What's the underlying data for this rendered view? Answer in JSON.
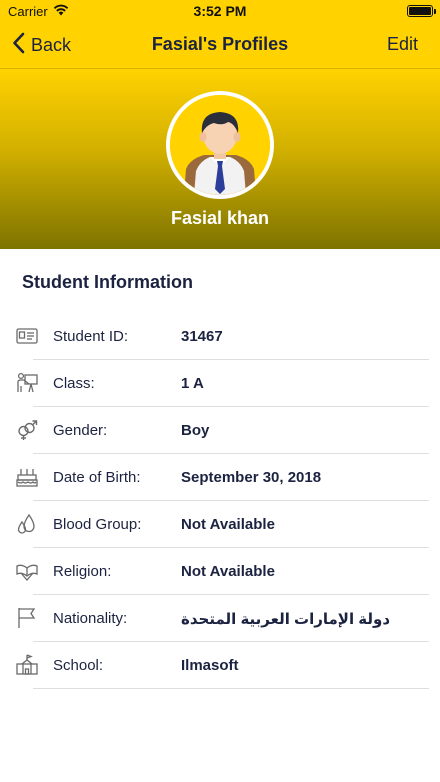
{
  "status_bar": {
    "carrier": "Carrier",
    "time": "3:52 PM"
  },
  "nav": {
    "back_label": "Back",
    "title": "Fasial's Profiles",
    "edit_label": "Edit"
  },
  "profile": {
    "name": "Fasial khan"
  },
  "section": {
    "title": "Student Information"
  },
  "fields": [
    {
      "icon": "id-card-icon",
      "label": "Student ID:",
      "value": "31467"
    },
    {
      "icon": "classroom-teacher-icon",
      "label": "Class:",
      "value": "1 A"
    },
    {
      "icon": "gender-icon",
      "label": "Gender:",
      "value": "Boy"
    },
    {
      "icon": "birthday-cake-icon",
      "label": "Date of Birth:",
      "value": "September 30, 2018"
    },
    {
      "icon": "blood-drops-icon",
      "label": "Blood Group:",
      "value": "Not Available"
    },
    {
      "icon": "religion-book-icon",
      "label": "Religion:",
      "value": "Not Available"
    },
    {
      "icon": "flag-icon",
      "label": "Nationality:",
      "value": "دولة الإمارات العربية المتحدة"
    },
    {
      "icon": "school-building-icon",
      "label": "School:",
      "value": "Ilmasoft"
    }
  ],
  "colors": {
    "accent": "#ffd200",
    "header_gradient_end": "#7d7300",
    "text_primary": "#1c2340",
    "icon_gray": "#6a6a6a",
    "divider": "#dedede"
  }
}
